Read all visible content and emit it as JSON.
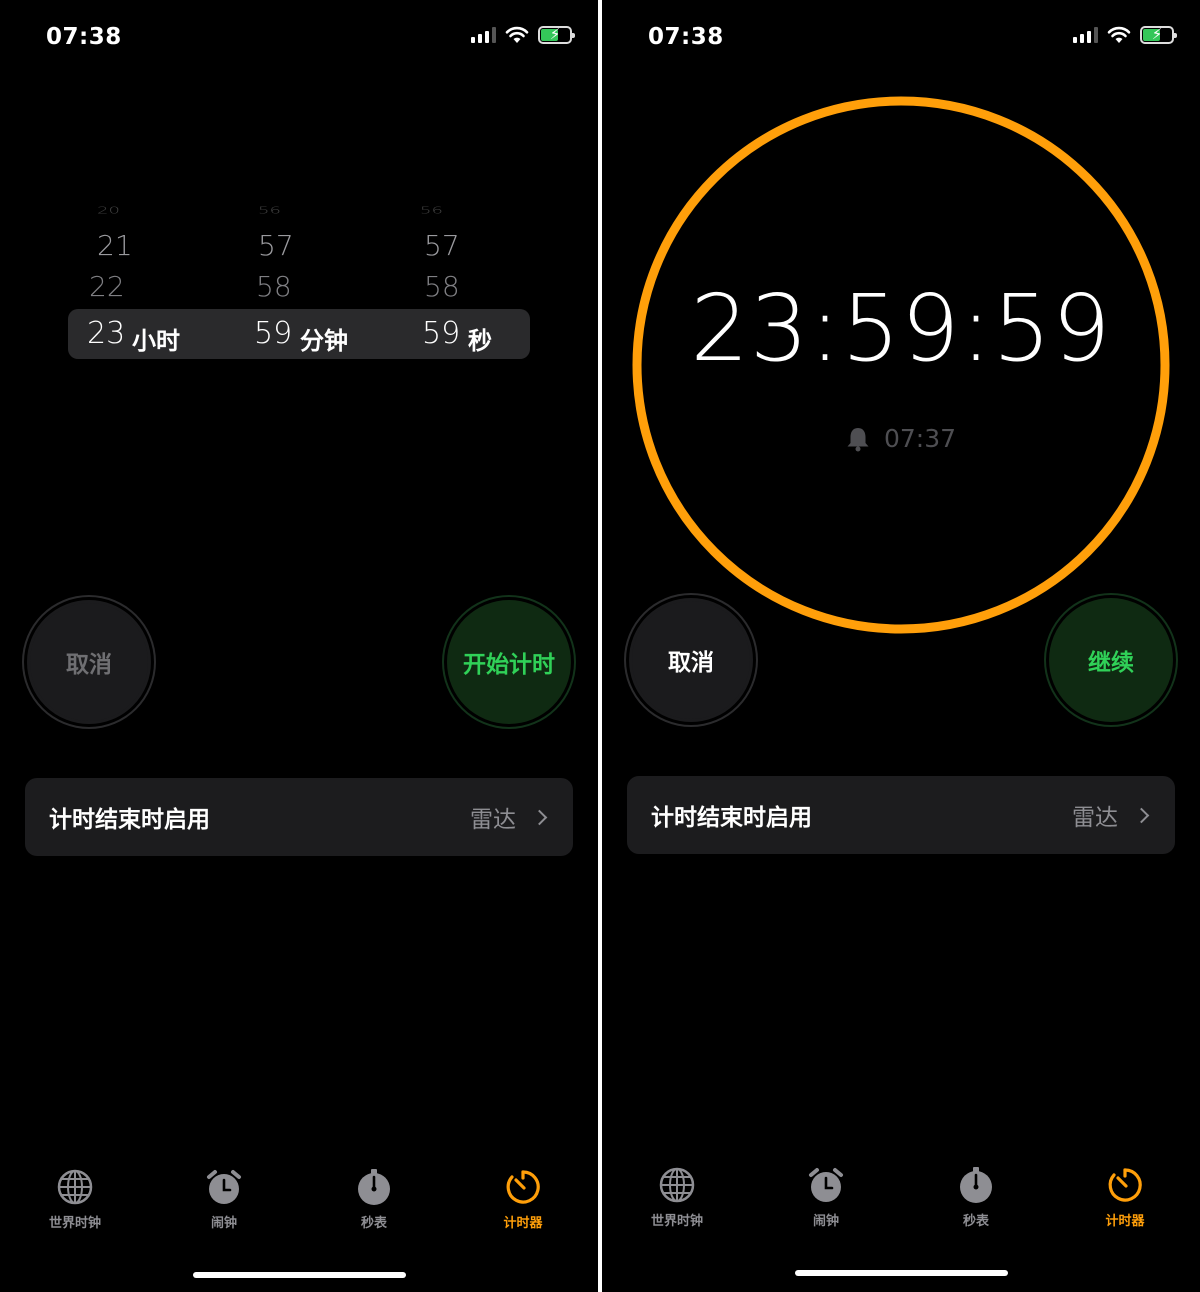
{
  "accent_orange": "#ff9f0a",
  "accent_green": "#30d158",
  "left": {
    "status": {
      "time": "07:38"
    },
    "picker": {
      "hours": {
        "faded": "20",
        "above2": "21",
        "above1": "22",
        "selected": "23",
        "unit": "小时"
      },
      "minutes": {
        "faded": "56",
        "above2": "57",
        "above1": "58",
        "selected": "59",
        "unit": "分钟"
      },
      "seconds": {
        "faded": "56",
        "above2": "57",
        "above1": "58",
        "selected": "59",
        "unit": "秒"
      }
    },
    "cancel_label": "取消",
    "start_label": "开始计时",
    "when_done": {
      "label": "计时结束时启用",
      "value": "雷达"
    },
    "tabs": [
      {
        "label": "世界时钟",
        "icon": "globe-icon"
      },
      {
        "label": "闹钟",
        "icon": "alarm-clock-icon"
      },
      {
        "label": "秒表",
        "icon": "stopwatch-icon"
      },
      {
        "label": "计时器",
        "icon": "timer-icon",
        "active": true
      }
    ]
  },
  "right": {
    "status": {
      "time": "07:38"
    },
    "countdown": "23:59:59",
    "end_time": "07:37",
    "progress_fraction": 1.0,
    "cancel_label": "取消",
    "resume_label": "继续",
    "when_done": {
      "label": "计时结束时启用",
      "value": "雷达"
    },
    "tabs": [
      {
        "label": "世界时钟",
        "icon": "globe-icon"
      },
      {
        "label": "闹钟",
        "icon": "alarm-clock-icon"
      },
      {
        "label": "秒表",
        "icon": "stopwatch-icon"
      },
      {
        "label": "计时器",
        "icon": "timer-icon",
        "active": true
      }
    ]
  }
}
